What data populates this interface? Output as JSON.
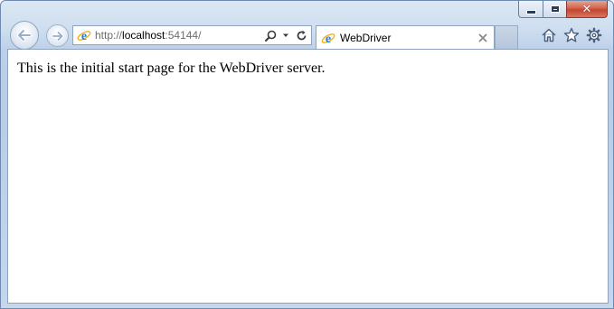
{
  "window": {
    "caption": {
      "minimize_icon": "minimize-icon",
      "maximize_icon": "maximize-icon",
      "close_icon": "close-icon",
      "close_glyph": "✕",
      "close_color": "#c44530"
    }
  },
  "navigation": {
    "back_icon": "back-arrow-icon",
    "forward_icon": "forward-arrow-icon"
  },
  "address_bar": {
    "scheme": "http://",
    "host": "localhost",
    "rest": ":54144/",
    "search_icon": "search-icon",
    "dropdown_icon": "chevron-down-icon",
    "refresh_icon": "refresh-icon"
  },
  "tabs": [
    {
      "title": "WebDriver",
      "icon": "ie-logo-icon",
      "close_icon": "close-icon",
      "active": true
    }
  ],
  "toolbar": {
    "home_icon": "home-icon",
    "favorites_icon": "star-icon",
    "tools_icon": "gear-icon"
  },
  "page": {
    "text": "This is the initial start page for the WebDriver server."
  },
  "colors": {
    "frame": "#bdd0e8",
    "border": "#8ea3bf",
    "ie_blue": "#1e7ed6",
    "ie_gold": "#f2b01e"
  }
}
